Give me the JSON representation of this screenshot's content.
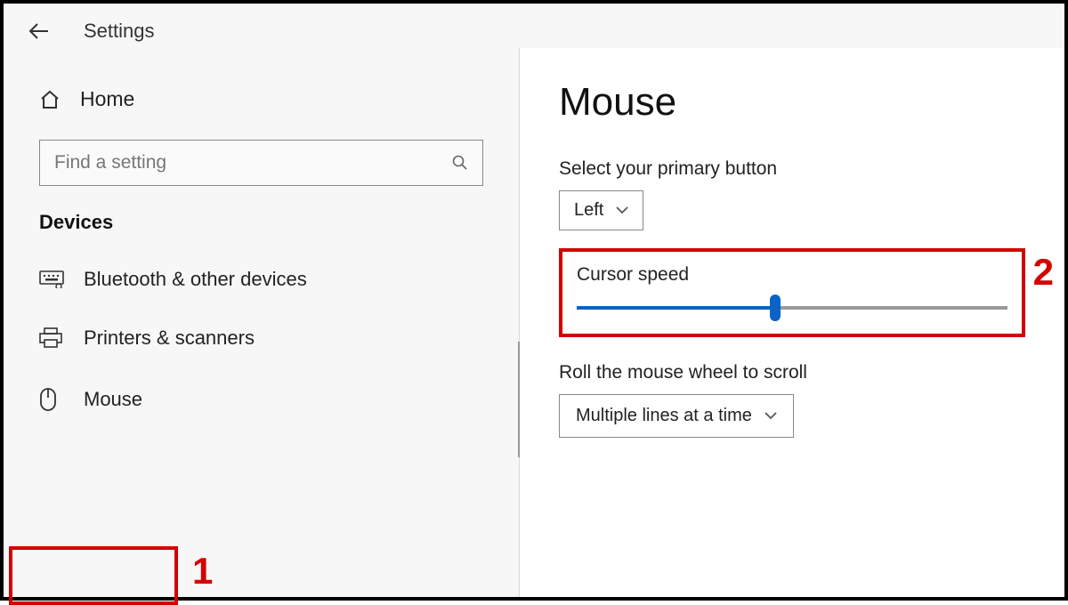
{
  "header": {
    "title": "Settings"
  },
  "sidebar": {
    "home_label": "Home",
    "search_placeholder": "Find a setting",
    "category_label": "Devices",
    "items": [
      {
        "label": "Bluetooth & other devices"
      },
      {
        "label": "Printers & scanners"
      },
      {
        "label": "Mouse"
      }
    ]
  },
  "content": {
    "page_title": "Mouse",
    "primary_button_label": "Select your primary button",
    "primary_button_value": "Left",
    "cursor_speed_label": "Cursor speed",
    "cursor_speed_percent": 46,
    "scroll_label": "Roll the mouse wheel to scroll",
    "scroll_value": "Multiple lines at a time"
  },
  "annotations": {
    "n1": "1",
    "n2": "2"
  }
}
